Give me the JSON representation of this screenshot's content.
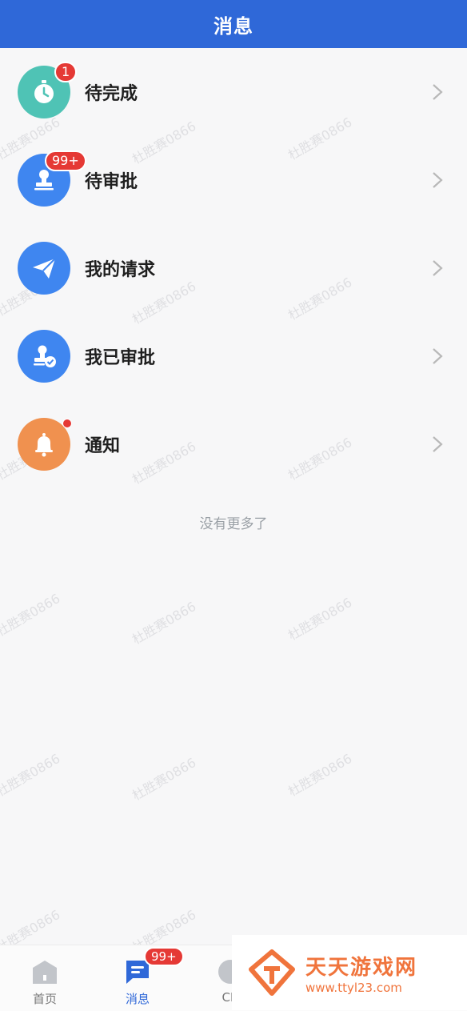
{
  "header": {
    "title": "消息"
  },
  "items": [
    {
      "label": "待完成",
      "icon": "stopwatch-icon",
      "color": "#4fc3b5",
      "badge": "1"
    },
    {
      "label": "待审批",
      "icon": "stamp-icon",
      "color": "#3f86f0",
      "badge": "99+"
    },
    {
      "label": "我的请求",
      "icon": "paper-plane-icon",
      "color": "#3f86f0",
      "badge": ""
    },
    {
      "label": "我已审批",
      "icon": "stamp-check-icon",
      "color": "#3f86f0",
      "badge": ""
    },
    {
      "label": "通知",
      "icon": "bell-icon",
      "color": "#f0914f",
      "badge": "",
      "dot": true
    }
  ],
  "footer_note": "没有更多了",
  "watermark_text": "杜胜赛0866",
  "tabbar": {
    "tabs": [
      {
        "label": "首页",
        "icon": "home-icon"
      },
      {
        "label": "消息",
        "icon": "message-icon",
        "badge": "99+",
        "active": true
      },
      {
        "label": "CR",
        "icon": "cr-icon"
      }
    ]
  },
  "ad": {
    "brand": "天天游戏网",
    "url": "www.ttyl23.com"
  }
}
